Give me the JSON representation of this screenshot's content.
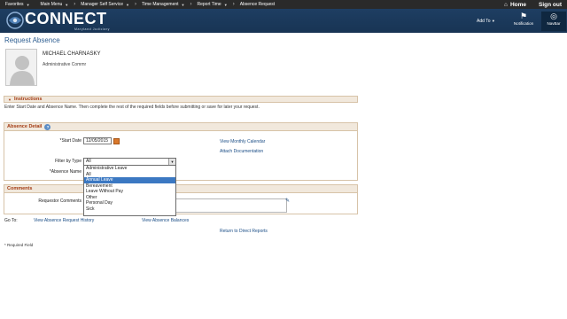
{
  "topnav": {
    "items": [
      "Favorites",
      "Main Menu",
      "Manager Self Service",
      "Time Management",
      "Report Time",
      "Absence Request"
    ],
    "home": "Home",
    "signout": "Sign out"
  },
  "brand": {
    "wordmark": "CONNECT",
    "sub": "Maryland Judiciary",
    "add_to": "Add To",
    "notification": "Notification",
    "navbar": "NavBar"
  },
  "page": {
    "title": "Request Absence"
  },
  "employee": {
    "name": "MICHAEL CHARNASKY",
    "title": "Administrative Commr"
  },
  "instructions": {
    "header": "Instructions",
    "text": "Enter Start Date and Absence Name. Then complete the rest of the required fields before submitting or save for later your request."
  },
  "absence_detail": {
    "header": "Absence Detail",
    "start_date_label": "*Start Date",
    "start_date_value": "12/05/2015",
    "filter_label": "Filter by Type",
    "filter_value": "All",
    "absence_name_label": "*Absence Name",
    "view_calendar": "View Monthly Calendar",
    "attach_doc": "Attach Documentation",
    "options": [
      "Administrative Leave",
      "All",
      "Annual Leave",
      "Bereavement",
      "Leave Without Pay",
      "Other",
      "Personal Day",
      "Sick"
    ],
    "highlighted_option": "Annual Leave"
  },
  "comments": {
    "header": "Comments",
    "requestor_label": "Requestor Comments"
  },
  "goto": {
    "label": "Go To:",
    "history": "View Absence Request History",
    "balances": "View Absence Balances",
    "return": "Return to Direct Reports"
  },
  "footer": {
    "required": "* Required Field"
  },
  "colors": {
    "header_bg": "#1e3e62",
    "link": "#1a4d86",
    "section_text": "#a33a12",
    "selected": "#3b78c2"
  }
}
